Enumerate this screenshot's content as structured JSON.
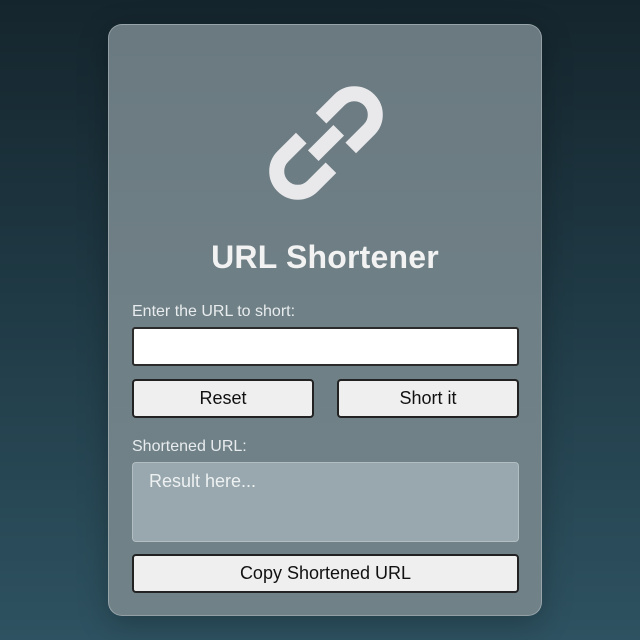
{
  "app": {
    "title": "URL Shortener",
    "logo_icon": "link-icon"
  },
  "form": {
    "url_label": "Enter the URL to short:",
    "url_value": "",
    "reset_label": "Reset",
    "short_label": "Short it",
    "result_label": "Shortened URL:",
    "result_placeholder": "Result here...",
    "copy_label": "Copy Shortened URL"
  },
  "colors": {
    "background_top": "#15252d",
    "background_bottom": "#2e5261",
    "card": "#6f8086",
    "result_box": "#98a8ae",
    "button": "#efefef"
  }
}
